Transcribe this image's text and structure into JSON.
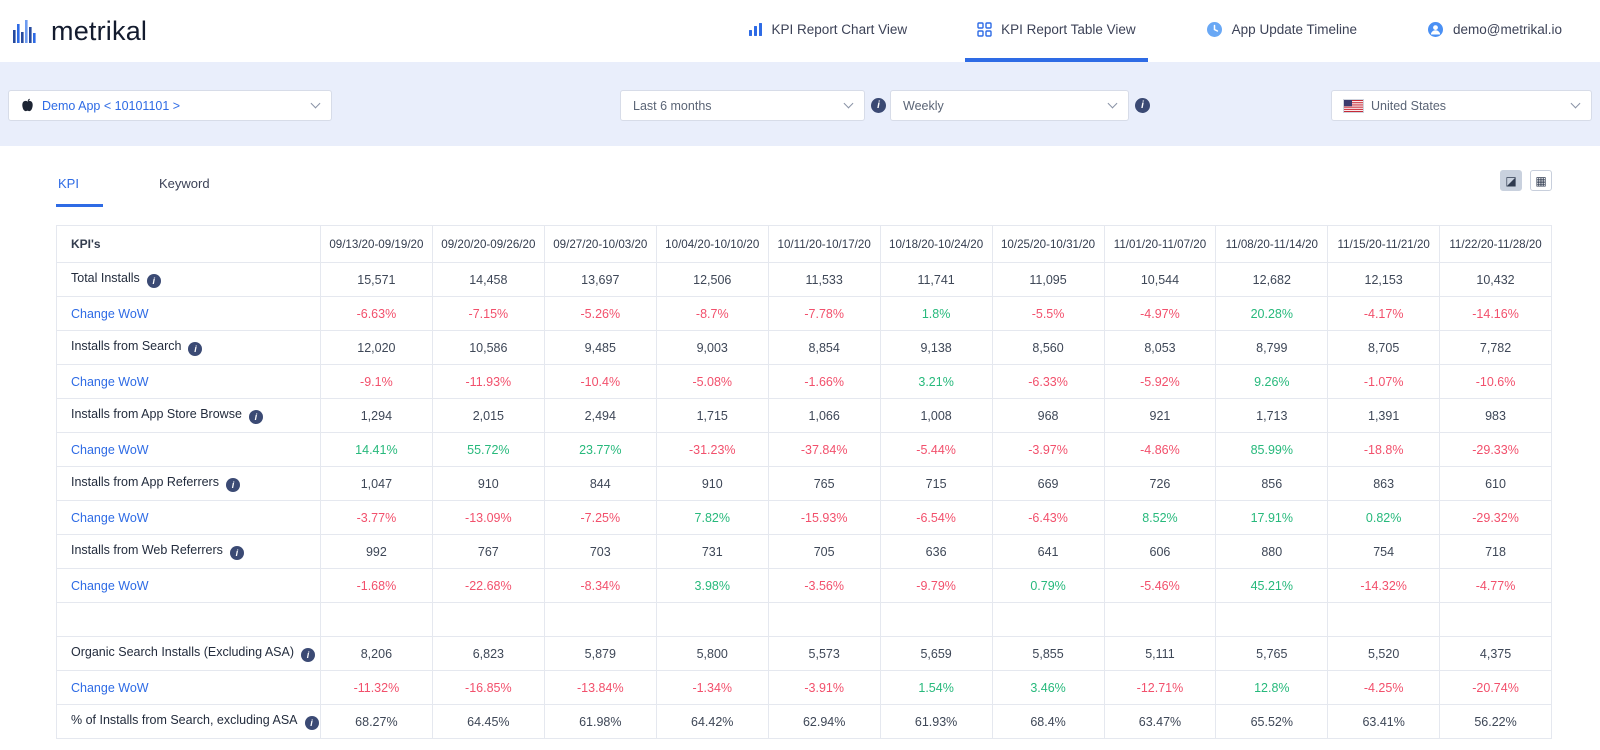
{
  "header": {
    "logo_text": "metrikal",
    "nav": [
      {
        "label": "KPI Report Chart View"
      },
      {
        "label": "KPI Report Table View"
      },
      {
        "label": "App Update Timeline"
      },
      {
        "label": "demo@metrikal.io"
      }
    ]
  },
  "filters": {
    "app_selector": "Demo App < 10101101 >",
    "date_range": "Last 6 months",
    "granularity": "Weekly",
    "country": "United States"
  },
  "tabs": {
    "kpi": "KPI",
    "keyword": "Keyword"
  },
  "icons": {
    "export_image_glyph": "◪",
    "export_table_glyph": "▦"
  },
  "colors": {
    "accent": "#2e6be5",
    "positive": "#27b97c",
    "negative": "#f2506c",
    "filter_band": "#e9eefb"
  },
  "table": {
    "kpi_header": "KPI's",
    "columns": [
      "09/13/20-09/19/20",
      "09/20/20-09/26/20",
      "09/27/20-10/03/20",
      "10/04/20-10/10/20",
      "10/11/20-10/17/20",
      "10/18/20-10/24/20",
      "10/25/20-10/31/20",
      "11/01/20-11/07/20",
      "11/08/20-11/14/20",
      "11/15/20-11/21/20",
      "11/22/20-11/28/20"
    ],
    "rows": [
      {
        "label": "Total Installs",
        "info": true,
        "type": "value",
        "values": [
          "15,571",
          "14,458",
          "13,697",
          "12,506",
          "11,533",
          "11,741",
          "11,095",
          "10,544",
          "12,682",
          "12,153",
          "10,432"
        ]
      },
      {
        "label": "Change WoW",
        "type": "change",
        "values": [
          "-6.63%",
          "-7.15%",
          "-5.26%",
          "-8.7%",
          "-7.78%",
          "1.8%",
          "-5.5%",
          "-4.97%",
          "20.28%",
          "-4.17%",
          "-14.16%"
        ]
      },
      {
        "label": "Installs from Search",
        "info": true,
        "type": "value",
        "values": [
          "12,020",
          "10,586",
          "9,485",
          "9,003",
          "8,854",
          "9,138",
          "8,560",
          "8,053",
          "8,799",
          "8,705",
          "7,782"
        ]
      },
      {
        "label": "Change WoW",
        "type": "change",
        "values": [
          "-9.1%",
          "-11.93%",
          "-10.4%",
          "-5.08%",
          "-1.66%",
          "3.21%",
          "-6.33%",
          "-5.92%",
          "9.26%",
          "-1.07%",
          "-10.6%"
        ]
      },
      {
        "label": "Installs from App Store Browse",
        "info": true,
        "type": "value",
        "values": [
          "1,294",
          "2,015",
          "2,494",
          "1,715",
          "1,066",
          "1,008",
          "968",
          "921",
          "1,713",
          "1,391",
          "983"
        ]
      },
      {
        "label": "Change WoW",
        "type": "change",
        "values": [
          "14.41%",
          "55.72%",
          "23.77%",
          "-31.23%",
          "-37.84%",
          "-5.44%",
          "-3.97%",
          "-4.86%",
          "85.99%",
          "-18.8%",
          "-29.33%"
        ]
      },
      {
        "label": "Installs from App Referrers",
        "info": true,
        "type": "value",
        "values": [
          "1,047",
          "910",
          "844",
          "910",
          "765",
          "715",
          "669",
          "726",
          "856",
          "863",
          "610"
        ]
      },
      {
        "label": "Change WoW",
        "type": "change",
        "values": [
          "-3.77%",
          "-13.09%",
          "-7.25%",
          "7.82%",
          "-15.93%",
          "-6.54%",
          "-6.43%",
          "8.52%",
          "17.91%",
          "0.82%",
          "-29.32%"
        ]
      },
      {
        "label": "Installs from Web Referrers",
        "info": true,
        "type": "value",
        "values": [
          "992",
          "767",
          "703",
          "731",
          "705",
          "636",
          "641",
          "606",
          "880",
          "754",
          "718"
        ]
      },
      {
        "label": "Change WoW",
        "type": "change",
        "values": [
          "-1.68%",
          "-22.68%",
          "-8.34%",
          "3.98%",
          "-3.56%",
          "-9.79%",
          "0.79%",
          "-5.46%",
          "45.21%",
          "-14.32%",
          "-4.77%"
        ]
      },
      {
        "type": "spacer"
      },
      {
        "label": "Organic Search Installs (Excluding ASA)",
        "info": true,
        "type": "value",
        "values": [
          "8,206",
          "6,823",
          "5,879",
          "5,800",
          "5,573",
          "5,659",
          "5,855",
          "5,111",
          "5,765",
          "5,520",
          "4,375"
        ]
      },
      {
        "label": "Change WoW",
        "type": "change",
        "values": [
          "-11.32%",
          "-16.85%",
          "-13.84%",
          "-1.34%",
          "-3.91%",
          "1.54%",
          "3.46%",
          "-12.71%",
          "12.8%",
          "-4.25%",
          "-20.74%"
        ]
      },
      {
        "label": "% of Installs from Search, excluding ASA",
        "info": true,
        "type": "value",
        "values": [
          "68.27%",
          "64.45%",
          "61.98%",
          "64.42%",
          "62.94%",
          "61.93%",
          "68.4%",
          "63.47%",
          "65.52%",
          "63.41%",
          "56.22%"
        ]
      }
    ]
  }
}
